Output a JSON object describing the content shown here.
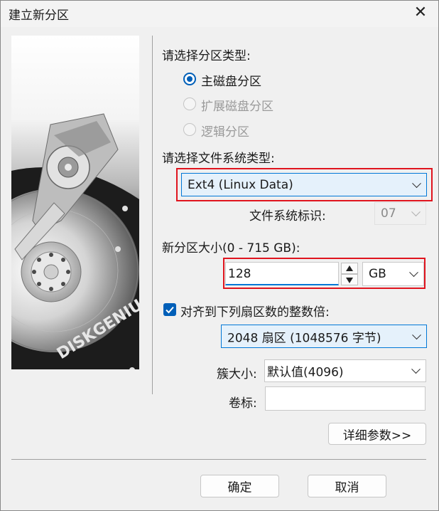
{
  "window": {
    "title": "建立新分区"
  },
  "partition_type": {
    "prompt": "请选择分区类型:",
    "options": [
      {
        "label": "主磁盘分区",
        "selected": true,
        "enabled": true
      },
      {
        "label": "扩展磁盘分区",
        "selected": false,
        "enabled": false
      },
      {
        "label": "逻辑分区",
        "selected": false,
        "enabled": false
      }
    ]
  },
  "filesystem": {
    "prompt": "请选择文件系统类型:",
    "selected": "Ext4 (Linux Data)",
    "id_label": "文件系统标识:",
    "id_value": "07"
  },
  "size": {
    "label": "新分区大小(0 - 715 GB):",
    "value": "128",
    "unit": "GB"
  },
  "alignment": {
    "checkbox_label": "对齐到下列扇区数的整数倍:",
    "checked": true,
    "selected": "2048 扇区 (1048576 字节)"
  },
  "cluster": {
    "label": "簇大小:",
    "value": "默认值(4096)"
  },
  "volume": {
    "label": "卷标:",
    "value": ""
  },
  "buttons": {
    "details": "详细参数>>",
    "ok": "确定",
    "cancel": "取消"
  },
  "image": {
    "brand_text": "DISKGENIUS"
  },
  "colors": {
    "accent": "#005fb8",
    "highlight_border": "#e0141e",
    "focus": "#0078d7"
  }
}
